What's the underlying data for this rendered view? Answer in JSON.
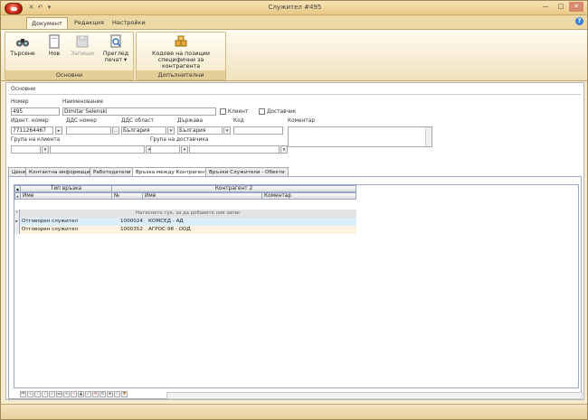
{
  "window": {
    "title": "Служител #495"
  },
  "ribbon_tabs": [
    "Документ",
    "Редакция",
    "Настройки"
  ],
  "ribbon": {
    "groups": [
      {
        "label": "Основни"
      },
      {
        "label": "Допълнителни"
      }
    ],
    "buttons": {
      "search": "Търсене",
      "new": "Нов",
      "save": "Запиши",
      "preview_l1": "Преглед",
      "preview_l2": "печат ▾",
      "codes_l1": "Кодове на позиции",
      "codes_l2": "специфични за контрагента"
    }
  },
  "section": {
    "title": "Основни"
  },
  "form": {
    "number_label": "Номер",
    "number_value": "495",
    "name_label": "Наименование",
    "name_value": "Dimitar Selenski",
    "client_label": "Клиент",
    "supplier_label": "Доставчик",
    "id_label": "Идент. номер",
    "id_value": "7711264467",
    "vat_label": "ДДС номер",
    "vat_value": "",
    "vat_area_label": "ДДС област",
    "vat_area_value": "България",
    "country_label": "Държава",
    "country_value": "България",
    "code_label": "Код",
    "code_value": "",
    "comment_label": "Коментар",
    "client_group_label": "Група на клиента",
    "client_group_value": "",
    "supplier_group_label": "Група на доставчика",
    "supplier_group_value": ""
  },
  "content_tabs": [
    "Цени",
    "Контактна информация",
    "Работодатели",
    "Връзка между Контрагенти",
    "Връзки Служители - Обекти"
  ],
  "grid": {
    "band_headers": [
      "Тип връзка",
      "Контрагент 2"
    ],
    "columns": [
      "Име",
      "№",
      "Име",
      "Коментар"
    ],
    "new_row_hint": "Натиснете тук, за да добавите нов запис",
    "rows": [
      {
        "type": "Отговорен служител",
        "number": "1000024",
        "name": "КОМСЕД - АД",
        "comment": ""
      },
      {
        "type": "Отговорен служител",
        "number": "1000352",
        "name": "АГРОС-98 - ООД",
        "comment": ""
      }
    ]
  }
}
